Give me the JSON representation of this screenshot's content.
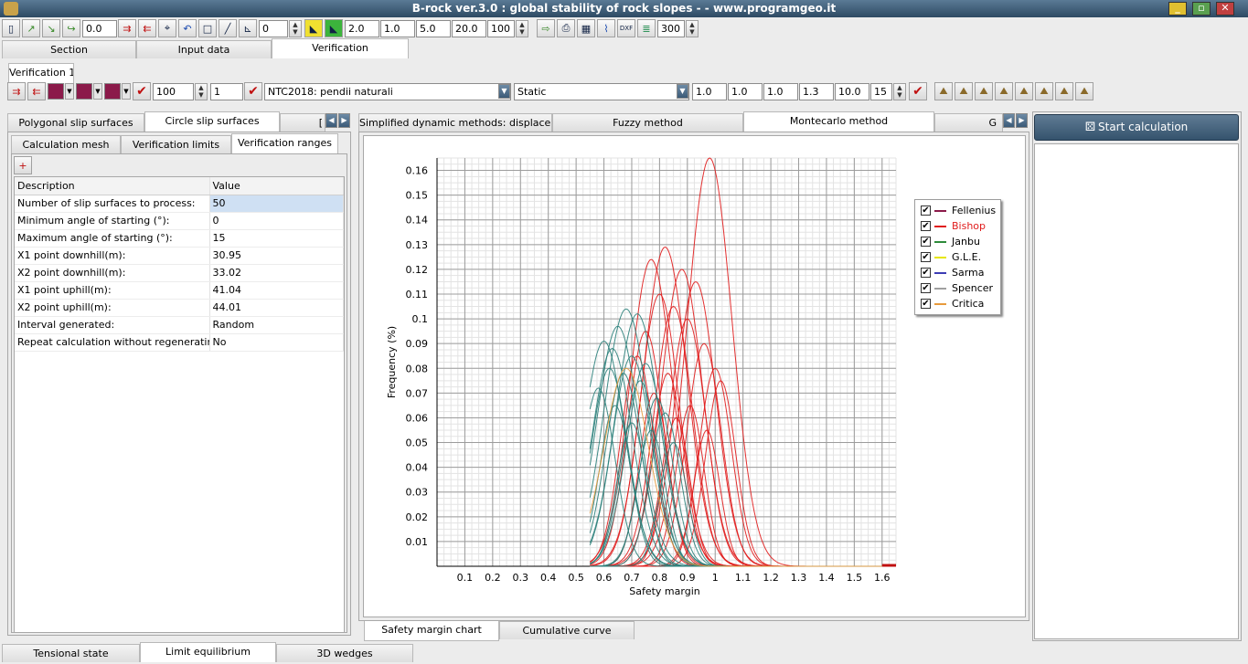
{
  "window": {
    "title": "B-rock ver.3.0 : global stability of rock slopes - - www.programgeo.it"
  },
  "toolbar": {
    "field1": "0.0",
    "field2": "0",
    "field3": "2.0",
    "field4": "1.0",
    "field5": "5.0",
    "field6": "20.0",
    "field7": "100",
    "field8": "300"
  },
  "main_tabs": [
    "Section",
    "Input data",
    "Verification"
  ],
  "verification_tab": "Verification 1",
  "verif_toolbar": {
    "count": "100",
    "index": "1",
    "code": "NTC2018: pendii naturali",
    "mode": "Static",
    "params": [
      "1.0",
      "1.0",
      "1.0",
      "1.3",
      "10.0",
      "15"
    ]
  },
  "left_tabs": [
    "Polygonal slip surfaces",
    "Circle slip surfaces",
    "["
  ],
  "sub_tabs": [
    "Calculation mesh",
    "Verification limits",
    "Verification ranges"
  ],
  "table": {
    "headers": [
      "Description",
      "Value"
    ],
    "rows": [
      [
        "Number of slip surfaces to process:",
        "50"
      ],
      [
        "Minimum angle of starting (°):",
        "0"
      ],
      [
        "Maximum angle of starting (°):",
        "15"
      ],
      [
        "X1 point downhill(m):",
        "30.95"
      ],
      [
        "X2 point downhill(m):",
        "33.02"
      ],
      [
        "X1 point uphill(m):",
        "41.04"
      ],
      [
        "X2 point uphill(m):",
        "44.01"
      ],
      [
        "Interval generated:",
        "Random"
      ],
      [
        "Repeat calculation without regenerating sur",
        "No"
      ]
    ]
  },
  "method_tabs": [
    "Simplified dynamic methods: displacements",
    "Fuzzy method",
    "Montecarlo method",
    "G"
  ],
  "chart_tabs": [
    "Safety margin chart",
    "Cumulative curve"
  ],
  "bottom_tabs": [
    "Tensional state",
    "Limit equilibrium",
    "3D wedges"
  ],
  "start_button": "Start calculation",
  "legend": [
    {
      "name": "Fellenius",
      "color": "#8b1a4a"
    },
    {
      "name": "Bishop",
      "color": "#e01b1b"
    },
    {
      "name": "Janbu",
      "color": "#2e8b3a"
    },
    {
      "name": "G.L.E.",
      "color": "#e6e600"
    },
    {
      "name": "Sarma",
      "color": "#3c3cb4"
    },
    {
      "name": "Spencer",
      "color": "#a0a0a0"
    },
    {
      "name": "Critica",
      "color": "#e89a3c"
    }
  ],
  "chart_data": {
    "type": "line",
    "xlabel": "Safety margin",
    "ylabel": "Frequency (%)",
    "xlim": [
      0,
      1.65
    ],
    "ylim": [
      0,
      0.165
    ],
    "xticks": [
      "0.1",
      "0.2",
      "0.3",
      "0.4",
      "0.5",
      "0.6",
      "0.7",
      "0.8",
      "0.9",
      "1",
      "1.1",
      "1.2",
      "1.3",
      "1.4",
      "1.5",
      "1.6"
    ],
    "yticks": [
      "0.01",
      "0.02",
      "0.03",
      "0.04",
      "0.05",
      "0.06",
      "0.07",
      "0.08",
      "0.09",
      "0.1",
      "0.11",
      "0.12",
      "0.13",
      "0.14",
      "0.15",
      "0.16"
    ],
    "grid": true,
    "legend_position": "top-right",
    "series": [
      {
        "name": "Bishop",
        "color": "#e01b1b",
        "curves": [
          {
            "mean": 0.98,
            "peak": 0.165
          },
          {
            "mean": 0.82,
            "peak": 0.129
          },
          {
            "mean": 0.77,
            "peak": 0.124
          },
          {
            "mean": 0.88,
            "peak": 0.12
          },
          {
            "mean": 0.93,
            "peak": 0.115
          },
          {
            "mean": 0.8,
            "peak": 0.11
          },
          {
            "mean": 0.85,
            "peak": 0.105
          },
          {
            "mean": 0.9,
            "peak": 0.1
          },
          {
            "mean": 0.75,
            "peak": 0.095
          },
          {
            "mean": 0.96,
            "peak": 0.09
          },
          {
            "mean": 0.72,
            "peak": 0.085
          },
          {
            "mean": 1.0,
            "peak": 0.08
          },
          {
            "mean": 0.83,
            "peak": 0.078
          },
          {
            "mean": 1.02,
            "peak": 0.075
          },
          {
            "mean": 0.78,
            "peak": 0.07
          },
          {
            "mean": 0.91,
            "peak": 0.065
          },
          {
            "mean": 0.86,
            "peak": 0.06
          },
          {
            "mean": 0.97,
            "peak": 0.055
          }
        ]
      },
      {
        "name": "Janbu",
        "color": "#2a7f7a",
        "curves": [
          {
            "mean": 0.68,
            "peak": 0.104
          },
          {
            "mean": 0.72,
            "peak": 0.102
          },
          {
            "mean": 0.65,
            "peak": 0.097
          },
          {
            "mean": 0.6,
            "peak": 0.091
          },
          {
            "mean": 0.63,
            "peak": 0.088
          },
          {
            "mean": 0.7,
            "peak": 0.085
          },
          {
            "mean": 0.75,
            "peak": 0.082
          },
          {
            "mean": 0.62,
            "peak": 0.08
          },
          {
            "mean": 0.67,
            "peak": 0.078
          },
          {
            "mean": 0.73,
            "peak": 0.075
          },
          {
            "mean": 0.58,
            "peak": 0.072
          },
          {
            "mean": 0.79,
            "peak": 0.068
          },
          {
            "mean": 0.64,
            "peak": 0.065
          },
          {
            "mean": 0.82,
            "peak": 0.062
          },
          {
            "mean": 0.7,
            "peak": 0.058
          },
          {
            "mean": 0.77,
            "peak": 0.055
          },
          {
            "mean": 0.85,
            "peak": 0.05
          }
        ]
      },
      {
        "name": "Critica",
        "color": "#e89a3c",
        "curves": [
          {
            "mean": 0.68,
            "peak": 0.08
          }
        ]
      }
    ]
  }
}
